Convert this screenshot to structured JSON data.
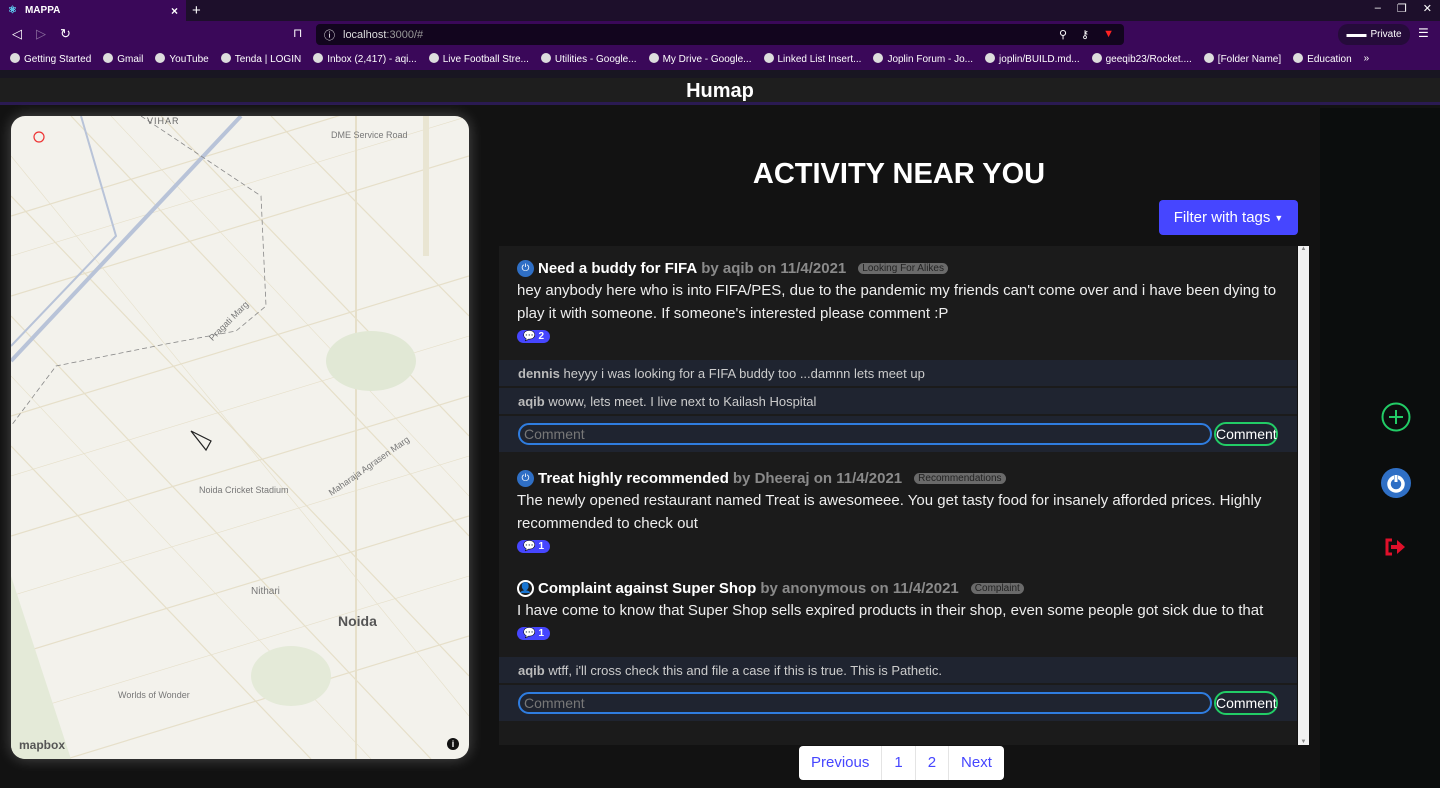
{
  "browser": {
    "tab_title": "MAPPA",
    "url_host": "localhost",
    "url_rest": ":3000/#",
    "private_label": "Private",
    "bookmarks": [
      "Getting Started",
      "Gmail",
      "YouTube",
      "Tenda | LOGIN",
      "Inbox (2,417) - aqi...",
      "Live Football Stre...",
      "Utilities - Google...",
      "My Drive - Google...",
      "Linked List Insert...",
      "Joplin Forum - Jo...",
      "joplin/BUILD.md...",
      "geeqib23/Rocket....",
      "[Folder Name]",
      "Education"
    ]
  },
  "app": {
    "title": "Humap"
  },
  "map": {
    "labels": {
      "dme": "DME Service Road",
      "pragati": "Pragati Marg",
      "stadium": "Noida Cricket Stadium",
      "agrasen": "Maharaja Agrasen Marg",
      "nithari": "Nithari",
      "noida": "Noida",
      "wow": "Worlds of Wonder",
      "vihar": "VIHAR"
    },
    "attribution": "mapbox"
  },
  "main": {
    "title": "ACTIVITY NEAR YOU",
    "filter_label": "Filter with tags",
    "comment_placeholder": "Comment",
    "comment_button": "Comment",
    "posts": [
      {
        "title": "Need a buddy for FIFA",
        "byline": "by aqib on 11/4/2021",
        "tag": "Looking For Alikes",
        "body": "hey anybody here who is into FIFA/PES, due to the pandemic my friends can't come over and i have been dying to play it with someone. If someone's interested please comment :P",
        "count": "2",
        "comments": [
          {
            "user": "dennis",
            "text": "heyyy i was looking for a FIFA buddy too ...damnn lets meet up"
          },
          {
            "user": "aqib",
            "text": "woww, lets meet. I live next to Kailash Hospital"
          }
        ]
      },
      {
        "title": "Treat highly recommended",
        "byline": "by Dheeraj on 11/4/2021",
        "tag": "Recommendations",
        "body": "The newly opened restaurant named Treat is awesomeee. You get tasty food for insanely afforded prices. Highly recommended to check out",
        "count": "1",
        "comments": []
      },
      {
        "title": "Complaint against Super Shop",
        "byline": "by anonymous on 11/4/2021",
        "tag": "Complaint",
        "body": "I have come to know that Super Shop sells expired products in their shop, even some people got sick due to that",
        "count": "1",
        "comments": [
          {
            "user": "aqib",
            "text": "wtff, i'll cross check this and file a case if this is true. This is Pathetic."
          }
        ]
      }
    ]
  },
  "pagination": {
    "previous": "Previous",
    "pages": [
      "1",
      "2"
    ],
    "next": "Next"
  },
  "colors": {
    "accent": "#4646ff",
    "add": "#22cc66",
    "logout": "#e0102a",
    "browser": "#3a0859"
  }
}
